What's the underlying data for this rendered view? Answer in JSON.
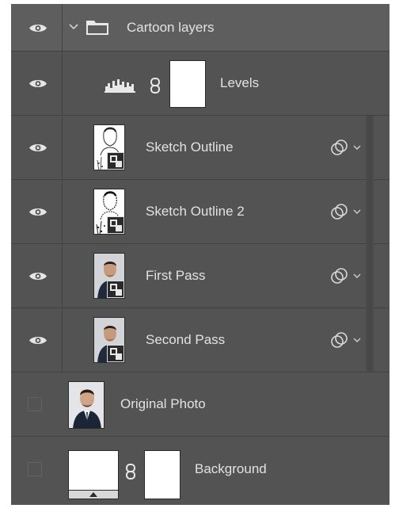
{
  "layers": {
    "group": {
      "name": "Cartoon layers",
      "visible": true,
      "expanded": true
    },
    "levels": {
      "name": "Levels",
      "visible": true
    },
    "sketch1": {
      "name": "Sketch Outline",
      "visible": true
    },
    "sketch2": {
      "name": "Sketch Outline 2",
      "visible": true
    },
    "first": {
      "name": "First Pass",
      "visible": true
    },
    "second": {
      "name": "Second Pass",
      "visible": true
    },
    "original": {
      "name": "Original Photo",
      "visible": false
    },
    "background": {
      "name": "Background",
      "visible": false
    }
  },
  "icons": {
    "eye": "eye-icon",
    "folder": "folder-icon",
    "levels": "histogram-icon",
    "link": "chain-link-icon",
    "blend": "blend-mode-icon"
  },
  "colors": {
    "panel": "#535353",
    "group_row": "#5e5e5e",
    "text": "#e2e2e2"
  }
}
